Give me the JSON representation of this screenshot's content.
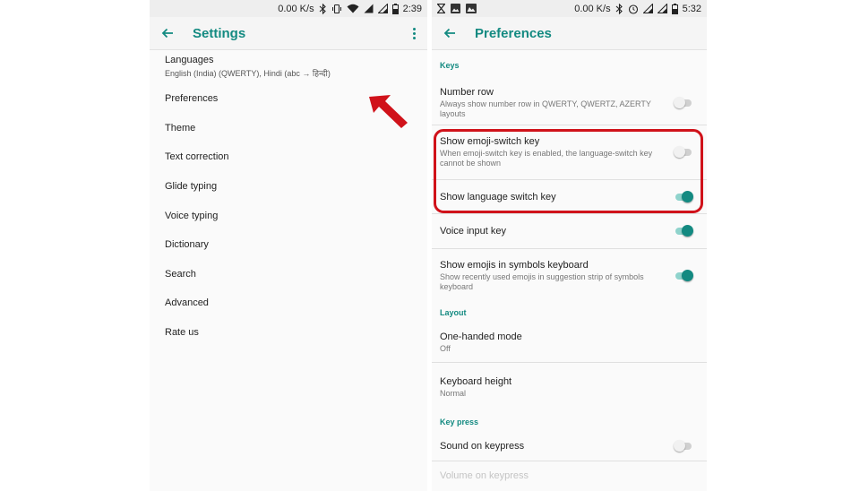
{
  "left_screen": {
    "status": {
      "speed": "0.00 K/s",
      "time": "2:39"
    },
    "title": "Settings",
    "items": [
      {
        "label": "Languages",
        "subtitle": "English (India) (QWERTY), Hindi (abc → हिन्दी)"
      },
      {
        "label": "Preferences"
      },
      {
        "label": "Theme"
      },
      {
        "label": "Text correction"
      },
      {
        "label": "Glide typing"
      },
      {
        "label": "Voice typing"
      },
      {
        "label": "Dictionary"
      },
      {
        "label": "Search"
      },
      {
        "label": "Advanced"
      },
      {
        "label": "Rate us"
      }
    ]
  },
  "right_screen": {
    "status": {
      "speed": "0.00 K/s",
      "time": "5:32"
    },
    "title": "Preferences",
    "sections": {
      "keys": "Keys",
      "layout": "Layout",
      "key_press": "Key press"
    },
    "prefs": {
      "number_row": {
        "title": "Number row",
        "subtitle": "Always show number row in QWERTY, QWERTZ, AZERTY layouts",
        "enabled": false
      },
      "emoji_switch": {
        "title": "Show emoji-switch key",
        "subtitle": "When emoji-switch key is enabled, the language-switch key cannot be shown",
        "enabled": false
      },
      "language_switch": {
        "title": "Show language switch key",
        "enabled": true
      },
      "voice_input": {
        "title": "Voice input key",
        "enabled": true
      },
      "emojis_symbols": {
        "title": "Show emojis in symbols keyboard",
        "subtitle": "Show recently used emojis in suggestion strip of symbols keyboard",
        "enabled": true
      },
      "one_handed": {
        "title": "One-handed mode",
        "subtitle": "Off"
      },
      "keyboard_height": {
        "title": "Keyboard height",
        "subtitle": "Normal"
      },
      "sound_keypress": {
        "title": "Sound on keypress",
        "enabled": false
      },
      "volume_keypress": {
        "title": "Volume on keypress"
      }
    }
  },
  "colors": {
    "accent": "#138a81",
    "annotation": "#d0121a"
  },
  "icons": [
    "back-arrow-icon",
    "more-vert-icon",
    "bluetooth-icon",
    "vibrate-icon",
    "wifi-icon",
    "signal-icon",
    "battery-icon",
    "hourglass-icon",
    "image-icon",
    "gallery-icon",
    "alarm-icon"
  ]
}
